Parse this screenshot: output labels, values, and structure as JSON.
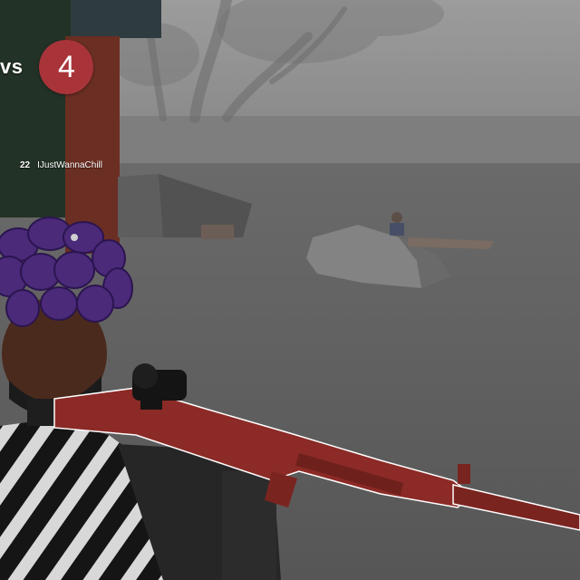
{
  "hud": {
    "vs_label": "vs",
    "score": "4",
    "score_color": "#a8343a"
  },
  "killfeed": [
    {
      "number": "22",
      "player": "IJustWannaChill"
    }
  ],
  "colors": {
    "fog": "#8a8a8a",
    "ground": "#5a5a5a",
    "rifle": "#8b2a26",
    "hair": "#4b2a7a"
  }
}
